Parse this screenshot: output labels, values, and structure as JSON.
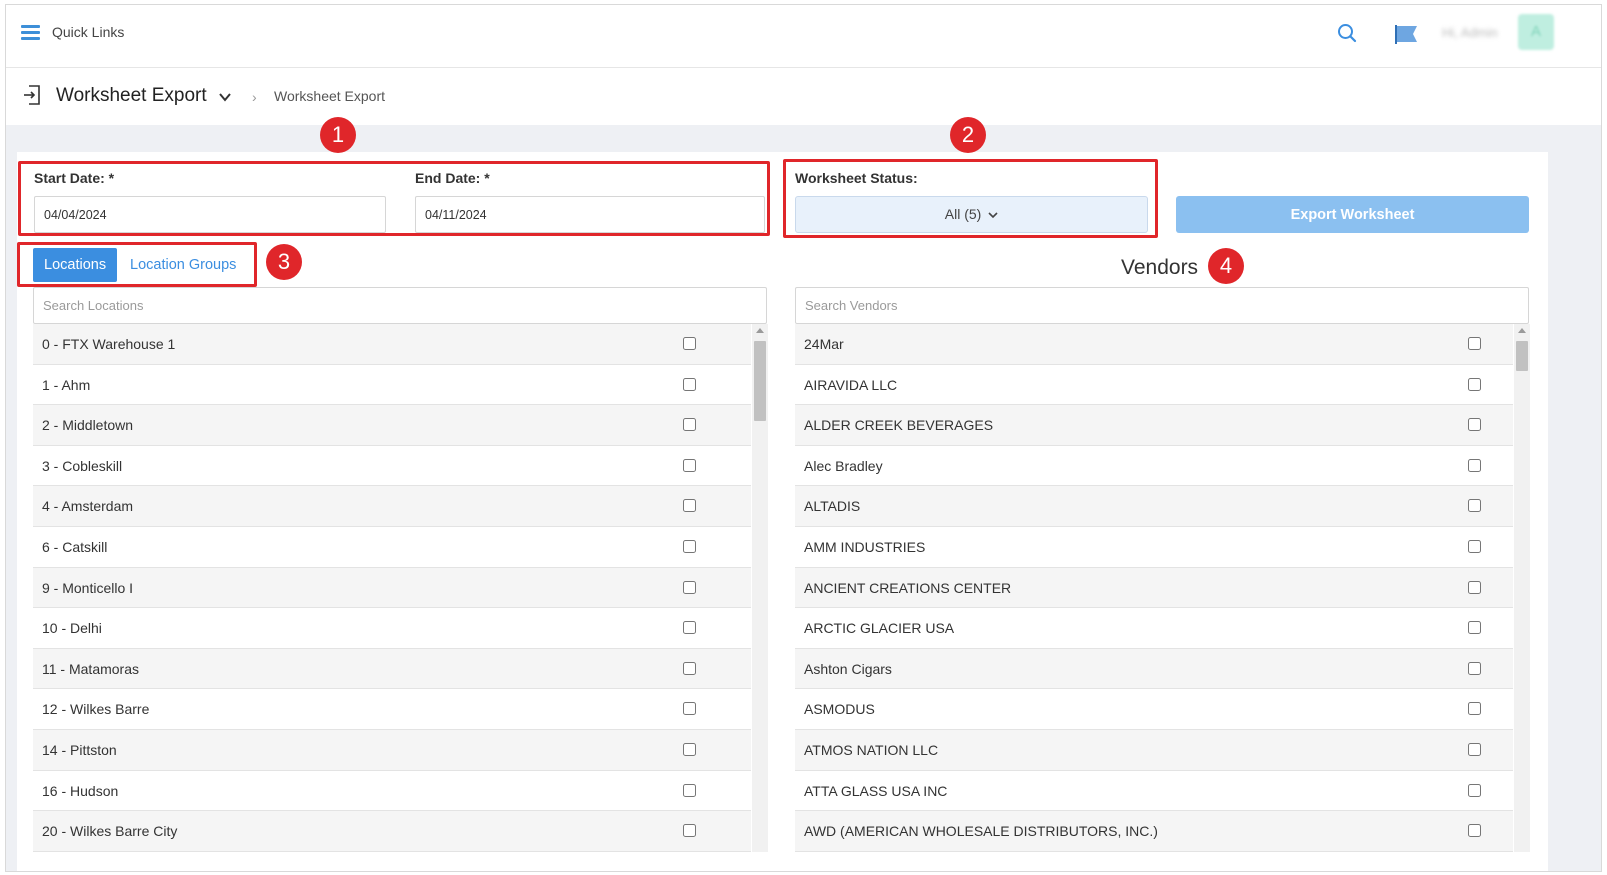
{
  "topbar": {
    "quick_links": "Quick Links",
    "admin_label": "Hi, Admin",
    "avatar_letter": "A"
  },
  "header": {
    "title": "Worksheet Export",
    "breadcrumb_current": "Worksheet Export"
  },
  "form": {
    "start_date_label": "Start Date: *",
    "start_date_value": "04/04/2024",
    "end_date_label": "End Date: *",
    "end_date_value": "04/11/2024",
    "status_label": "Worksheet Status:",
    "status_value": "All (5)",
    "export_button": "Export Worksheet"
  },
  "tabs": {
    "locations": "Locations",
    "location_groups": "Location Groups"
  },
  "locations": {
    "search_placeholder": "Search Locations",
    "items": [
      "0 - FTX Warehouse 1",
      "1 - Ahm",
      "2 - Middletown",
      "3 - Cobleskill",
      "4 - Amsterdam",
      "6 - Catskill",
      "9 - Monticello I",
      "10 - Delhi",
      "11 - Matamoras",
      "12 - Wilkes Barre",
      "14 - Pittston",
      "16 - Hudson",
      "20 - Wilkes Barre City"
    ]
  },
  "vendors": {
    "title": "Vendors",
    "search_placeholder": "Search Vendors",
    "items": [
      "24Mar",
      "AIRAVIDA LLC",
      "ALDER CREEK BEVERAGES",
      "Alec Bradley",
      "ALTADIS",
      "AMM INDUSTRIES",
      "ANCIENT CREATIONS CENTER",
      "ARCTIC GLACIER USA",
      "Ashton Cigars",
      "ASMODUS",
      "ATMOS NATION LLC",
      "ATTA GLASS USA INC",
      "AWD (AMERICAN WHOLESALE DISTRIBUTORS, INC.)"
    ]
  },
  "annotations": {
    "badge_1": "1",
    "badge_2": "2",
    "badge_3": "3",
    "badge_4": "4",
    "color": "#e0262a"
  },
  "colors": {
    "accent": "#3b8ee0",
    "export_button": "#8bc0f0",
    "status_select_bg": "#e8f1fb"
  },
  "icons": {
    "menu": "hamburger-menu-icon",
    "search": "search-icon",
    "flag": "flag-icon",
    "export": "export-icon",
    "chevron": "chevron-down-icon",
    "breadcrumb_sep": "chevron-right-icon"
  }
}
